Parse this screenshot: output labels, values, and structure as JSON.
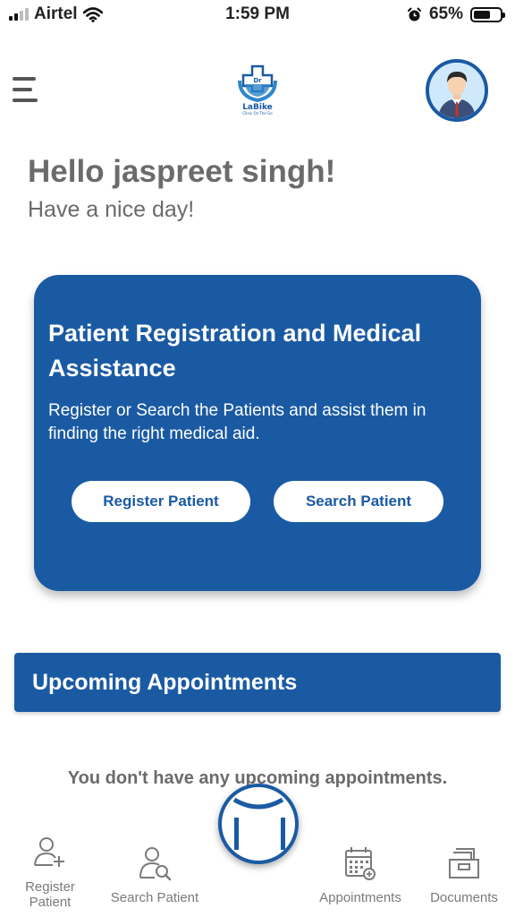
{
  "status_bar": {
    "carrier": "Airtel",
    "time": "1:59 PM",
    "battery_percent": "65%",
    "battery_level": 0.65,
    "icons": [
      "signal-icon",
      "wifi-icon",
      "alarm-icon",
      "battery-icon"
    ]
  },
  "header": {
    "logo_top_text": "Dr",
    "logo_text": "LaBike",
    "logo_tagline": "Clinic On The Go",
    "menu_icon": "hamburger-menu-icon",
    "avatar_icon": "profile-avatar-icon"
  },
  "greeting": {
    "title": "Hello jaspreet singh!",
    "subtitle": "Have a nice day!"
  },
  "card": {
    "title": "Patient Registration and Medical Assistance",
    "description": "Register or Search the Patients and assist them in finding the right medical aid.",
    "register_button": "Register Patient",
    "search_button": "Search Patient"
  },
  "upcoming": {
    "title": "Upcoming Appointments",
    "empty_message": "You don't have any upcoming appointments."
  },
  "bottom_nav": {
    "register_line1": "Register",
    "register_line2": "Patient",
    "search": "Search Patient",
    "appointments": "Appointments",
    "documents": "Documents"
  },
  "colors": {
    "primary": "#1a5aa3",
    "text_grey": "#6b6b6b",
    "nav_grey": "#7a7a7a",
    "background": "#ffffff"
  }
}
